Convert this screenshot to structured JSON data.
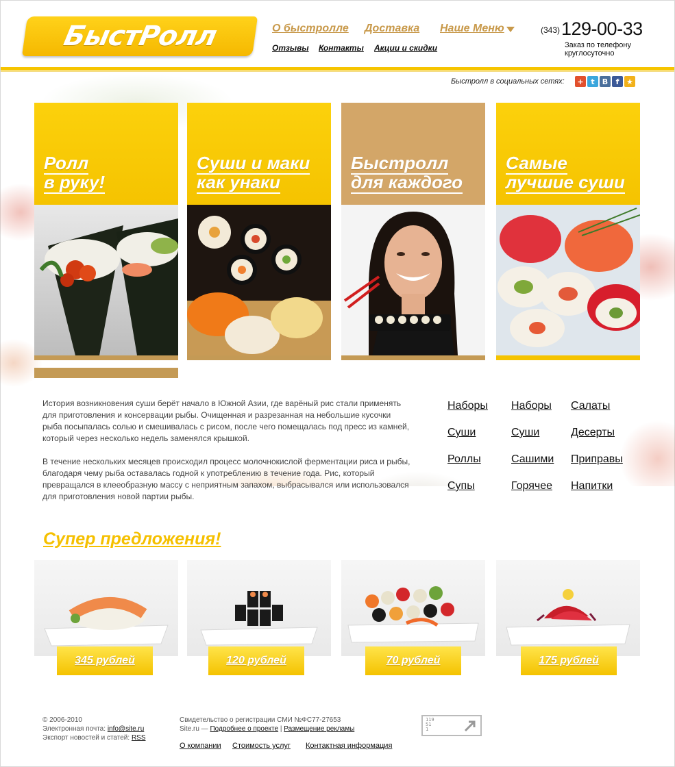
{
  "header": {
    "logo_text": "БыстРолл",
    "nav_main": [
      "О быстролле",
      "Доставка",
      "Наше Меню"
    ],
    "nav_sub": [
      "Отзывы",
      "Контакты",
      "Акции и скидки"
    ],
    "phone_code": "(343)",
    "phone_number": "129-00-33",
    "phone_note": "Заказ по телефону круглосуточно"
  },
  "social": {
    "label": "Быстролл в социальных сетях:",
    "icons": [
      {
        "name": "plus-icon",
        "glyph": "+",
        "color": "#e2502d"
      },
      {
        "name": "twitter-icon",
        "glyph": "t",
        "color": "#3aa6dc"
      },
      {
        "name": "vkontakte-icon",
        "glyph": "B",
        "color": "#4a6f9c"
      },
      {
        "name": "facebook-icon",
        "glyph": "f",
        "color": "#3b5998"
      },
      {
        "name": "star-icon",
        "glyph": "★",
        "color": "#f2b11a"
      }
    ]
  },
  "promo_cards": [
    {
      "line1": "Ролл",
      "line2": "в руку!"
    },
    {
      "line1": "Суши и маки",
      "line2": "как унаки"
    },
    {
      "line1": "Быстролл",
      "line2": "для каждого"
    },
    {
      "line1": "Самые",
      "line2": "лучшие суши"
    }
  ],
  "intro": [
    "История возникновения суши берёт начало в Южной Азии, где варёный рис стали применять для приготовления и консервации рыбы. Очищенная и разрезанная на небольшие кусочки рыба посыпалась солью и смешивалась с рисом, после чего помещалась под пресс из камней, который через несколько недель заменялся крышкой.",
    "В течение нескольких месяцев происходил процесс молочнокислой ферментации риса и рыбы, благодаря чему рыба оставалась годной к употреблению в течение года. Рис, который превращался в клееобразную массу с неприятным запахом, выбрасывался или использовался для приготовления новой партии рыбы."
  ],
  "menu_columns": [
    [
      "Наборы",
      "Суши",
      "Роллы",
      "Супы"
    ],
    [
      "Наборы",
      "Суши",
      "Сашими",
      "Горячее"
    ],
    [
      "Салаты",
      "Десерты",
      "Приправы",
      "Напитки"
    ]
  ],
  "offers_title": "Супер предложения!",
  "offers": [
    {
      "price": "345 рублей"
    },
    {
      "price": "120 рублей"
    },
    {
      "price": "70 рублей"
    },
    {
      "price": "175 рублей"
    }
  ],
  "footer": {
    "copyright": "© 2006-2010",
    "email_label": "Электронная почта:",
    "email": "info@site.ru",
    "export_label": "Экспорт новостей и статей:",
    "rss": "RSS",
    "registration": "Свидетельство о регистрации СМИ №ФС77-27653",
    "site_label": "Site.ru —",
    "more_link": "Подробнее о проекте",
    "separator": "|",
    "ads_link": "Размещение рекламы",
    "bottom_links": [
      "О компании",
      "Стоимость услуг",
      "Контактная информация"
    ],
    "counter_digits": [
      "119",
      "51",
      "1"
    ]
  }
}
